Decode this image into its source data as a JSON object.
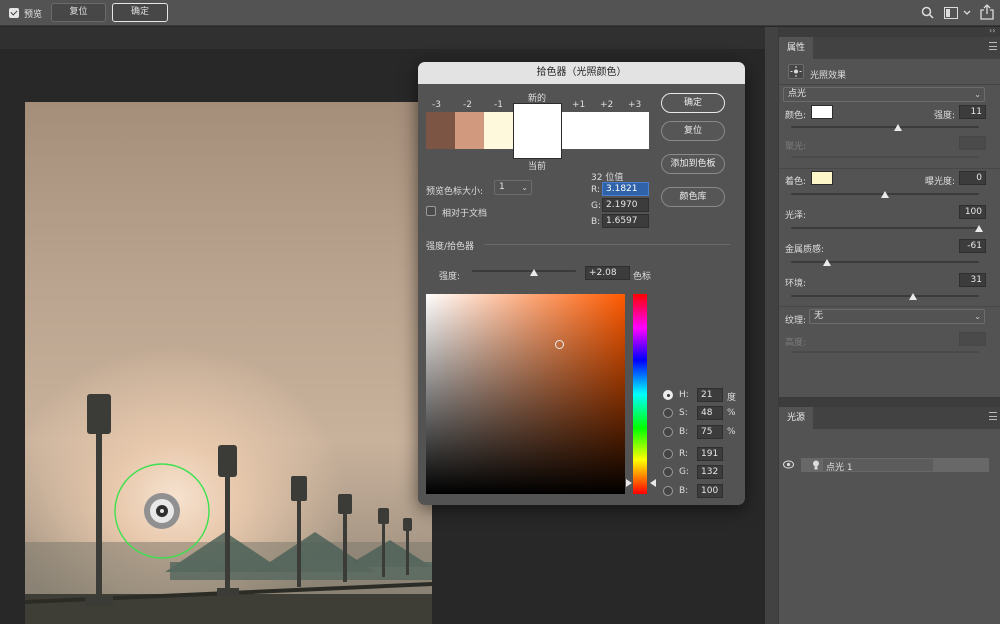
{
  "topbar": {
    "preview_label": "预览",
    "reset_label": "复位",
    "ok_label": "确定",
    "icons": [
      "search-icon",
      "panel-layout-icon",
      "chevron-down-icon",
      "share-icon"
    ]
  },
  "properties_panel": {
    "tab_label": "属性",
    "effect_title": "光照效果",
    "light_type": "点光",
    "color_label": "颜色:",
    "color_value": "#ffffff",
    "intensity_label": "强度:",
    "intensity_value": "11",
    "hotspot_label": "聚光:",
    "tint_label": "着色:",
    "tint_value": "#fdf6c9",
    "exposure_label": "曝光度:",
    "exposure_value": "0",
    "gloss_label": "光泽:",
    "gloss_value": "100",
    "metallic_label": "金属质感:",
    "metallic_value": "-61",
    "ambience_label": "环境:",
    "ambience_value": "31",
    "texture_label": "纹理:",
    "texture_value": "无",
    "height_label": "高度:",
    "slider_levels": {
      "intensity": 0.57,
      "tint": 0.5,
      "gloss": 1.0,
      "metallic": 0.19,
      "ambience": 0.65
    }
  },
  "lights_panel": {
    "tab_label": "光源",
    "items": [
      {
        "label": "点光 1"
      }
    ]
  },
  "color_picker": {
    "title": "拾色器（光照颜色）",
    "new_label": "新的",
    "current_label": "当前",
    "stops": [
      "-3",
      "-2",
      "-1",
      "+1",
      "+2",
      "+3"
    ],
    "stop_colors": [
      "#7d5545",
      "#d19a7e",
      "#fef9dd",
      "#ffffff",
      "#ffffff",
      "#ffffff"
    ],
    "ok_label": "确定",
    "reset_label": "复位",
    "add_swatch_label": "添加到色板",
    "color_libraries_label": "颜色库",
    "preview_size_label": "预览色标大小:",
    "preview_size_value": "1",
    "relative_to_doc_label": "相对于文档",
    "bit_label": "32 位值",
    "r_label": "R:",
    "r_value": "3.1821",
    "g_label": "G:",
    "g_value": "2.1970",
    "b_label": "B:",
    "b_value": "1.6597",
    "section_label": "强度/拾色器",
    "intensity_label": "强度:",
    "intensity_value": "+2.08",
    "intensity_unit": "色标",
    "intensity_level": 0.6,
    "hue_color": "#ff5a00",
    "picker_x": 0.67,
    "picker_y": 0.25,
    "hsb": {
      "h_label": "H:",
      "h_value": "21",
      "h_unit": "度",
      "s_label": "S:",
      "s_value": "48",
      "s_unit": "%",
      "b_label": "B:",
      "b_value": "75",
      "b_unit": "%"
    },
    "rgb": {
      "r_label": "R:",
      "r_value": "191",
      "g_label": "G:",
      "g_value": "132",
      "b_label": "B:",
      "b_value": "100"
    }
  }
}
